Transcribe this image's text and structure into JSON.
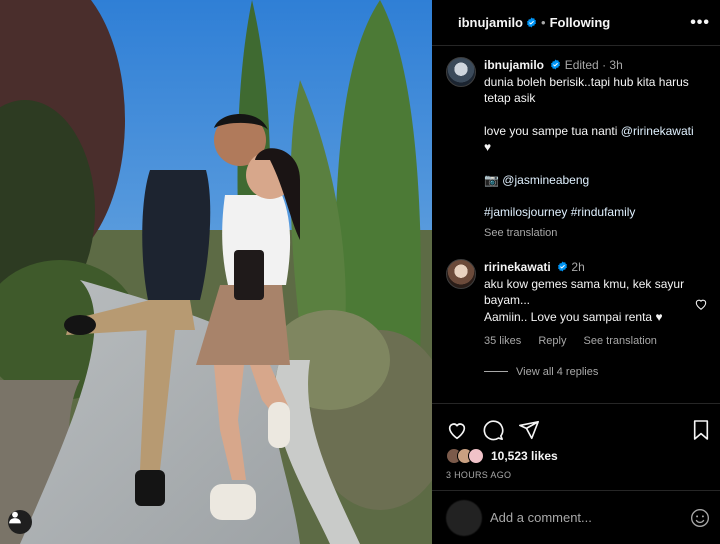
{
  "post": {
    "username": "ibnujamilo",
    "follow_status": "Following",
    "separator": "•",
    "more_icon": "more-horizontal-icon"
  },
  "caption": {
    "username": "ibnujamilo",
    "edited": "Edited",
    "time": "3h",
    "line1": "dunia boleh berisik..tapi hub kita harus tetap asik",
    "line2": "love you sampe tua nanti",
    "mention": "@ririnekawati",
    "heart": "♥",
    "camera": "📷",
    "photo_credit": "@jasmineabeng",
    "hashtags": "#jamilosjourney #rindufamily",
    "see_translation": "See translation"
  },
  "comment": {
    "username": "ririnekawati",
    "time": "2h",
    "line1": "aku kow gemes sama kmu, kek sayur bayam...",
    "line2": "Aamiin.. Love you sampai renta",
    "heart": "♥",
    "likes": "35 likes",
    "reply": "Reply",
    "see_translation": "See translation",
    "view_replies": "View all 4 replies"
  },
  "engagement": {
    "likes": "10,523 likes",
    "time_ago": "3 HOURS AGO"
  },
  "composer": {
    "placeholder": "Add a comment..."
  },
  "colors": {
    "background": "#000000",
    "verified": "#0095f6",
    "muted": "#a8a8a8",
    "divider": "#262626"
  }
}
